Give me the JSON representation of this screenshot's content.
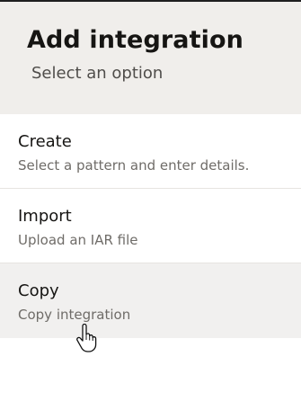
{
  "dialog": {
    "title": "Add integration",
    "subtitle": "Select an option"
  },
  "options": [
    {
      "label": "Create",
      "description": "Select a pattern and enter details."
    },
    {
      "label": "Import",
      "description": "Upload an IAR file"
    },
    {
      "label": "Copy",
      "description": "Copy integration"
    }
  ],
  "cursor": {
    "icon": "hand-pointer-icon"
  }
}
